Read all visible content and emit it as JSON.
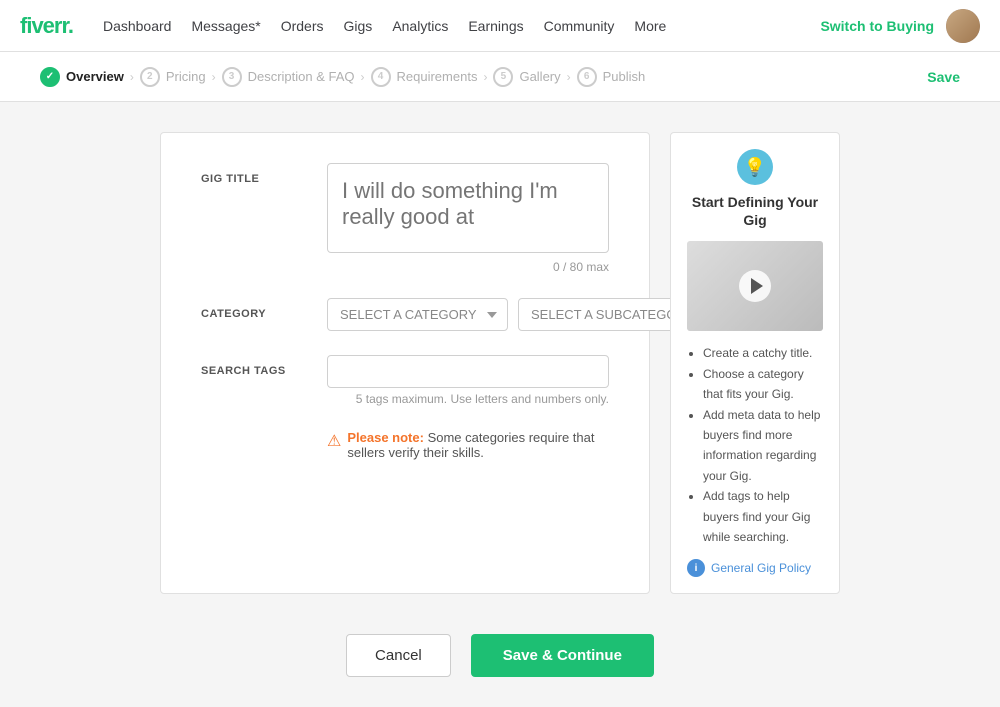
{
  "nav": {
    "logo": "fiverr.",
    "links": [
      "Dashboard",
      "Messages*",
      "Orders",
      "Gigs",
      "Analytics",
      "Earnings",
      "Community",
      "More"
    ],
    "switch_btn": "Switch to Buying"
  },
  "steps": [
    {
      "num": "1",
      "label": "Overview",
      "active": true
    },
    {
      "num": "2",
      "label": "Pricing"
    },
    {
      "num": "3",
      "label": "Description & FAQ"
    },
    {
      "num": "4",
      "label": "Requirements"
    },
    {
      "num": "5",
      "label": "Gallery"
    },
    {
      "num": "6",
      "label": "Publish"
    }
  ],
  "step_save": "Save",
  "form": {
    "gig_title_label": "GIG TITLE",
    "gig_title_placeholder": "I will do something I'm really good at",
    "char_count": "0 / 80 max",
    "category_label": "CATEGORY",
    "category_placeholder": "SELECT A CATEGORY",
    "subcategory_placeholder": "SELECT A SUBCATEGORY",
    "search_tags_label": "SEARCH TAGS",
    "search_tags_placeholder": "",
    "tags_hint": "5 tags maximum. Use letters and numbers only.",
    "note": "Please note:",
    "note_text": " Some categories require that sellers verify their skills."
  },
  "info_card": {
    "title": "Start Defining Your Gig",
    "tips": [
      "Create a catchy title.",
      "Choose a category that fits your Gig.",
      "Add meta data to help buyers find more information regarding your Gig.",
      "Add tags to help buyers find your Gig while searching."
    ],
    "policy_link": "General Gig Policy"
  },
  "buttons": {
    "cancel": "Cancel",
    "save_continue": "Save & Continue"
  }
}
